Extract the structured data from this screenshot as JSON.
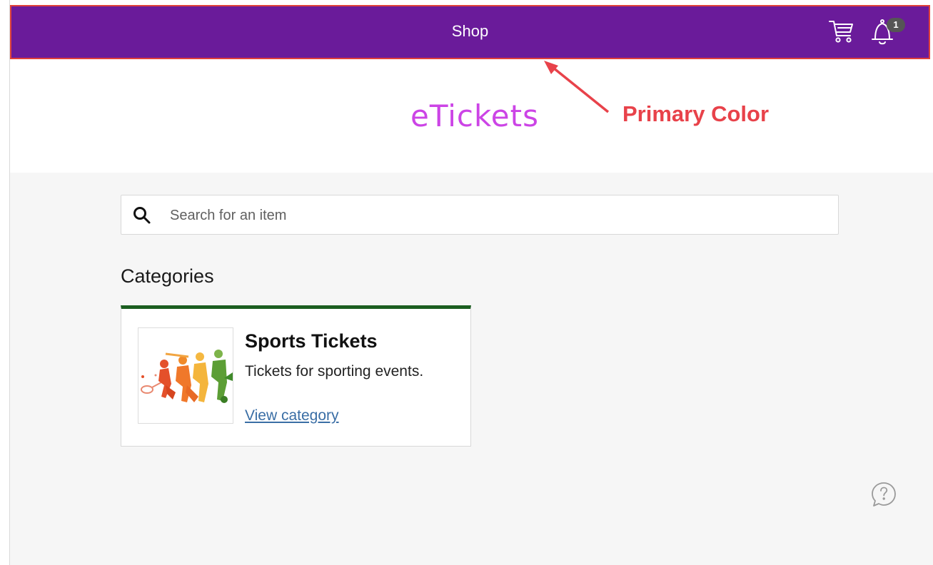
{
  "top_bar": {
    "title": "Shop",
    "cart_icon": "shopping-cart-icon",
    "bell_icon": "bell-icon",
    "notification_count": "1",
    "color": "#6a1b9a"
  },
  "brand": {
    "logo_text": "eTickets",
    "color": "#cc44e6"
  },
  "annotation": {
    "label": "Primary Color",
    "color": "#e8424a"
  },
  "search": {
    "placeholder": "Search for an item",
    "value": "",
    "icon": "search-icon"
  },
  "categories": {
    "heading": "Categories",
    "accent_color": "#1b5e20",
    "items": [
      {
        "title": "Sports Tickets",
        "description": "Tickets for sporting events.",
        "link_label": "View category",
        "image": "sports-silhouettes-image"
      }
    ]
  },
  "help": {
    "icon": "help-chat-icon"
  }
}
